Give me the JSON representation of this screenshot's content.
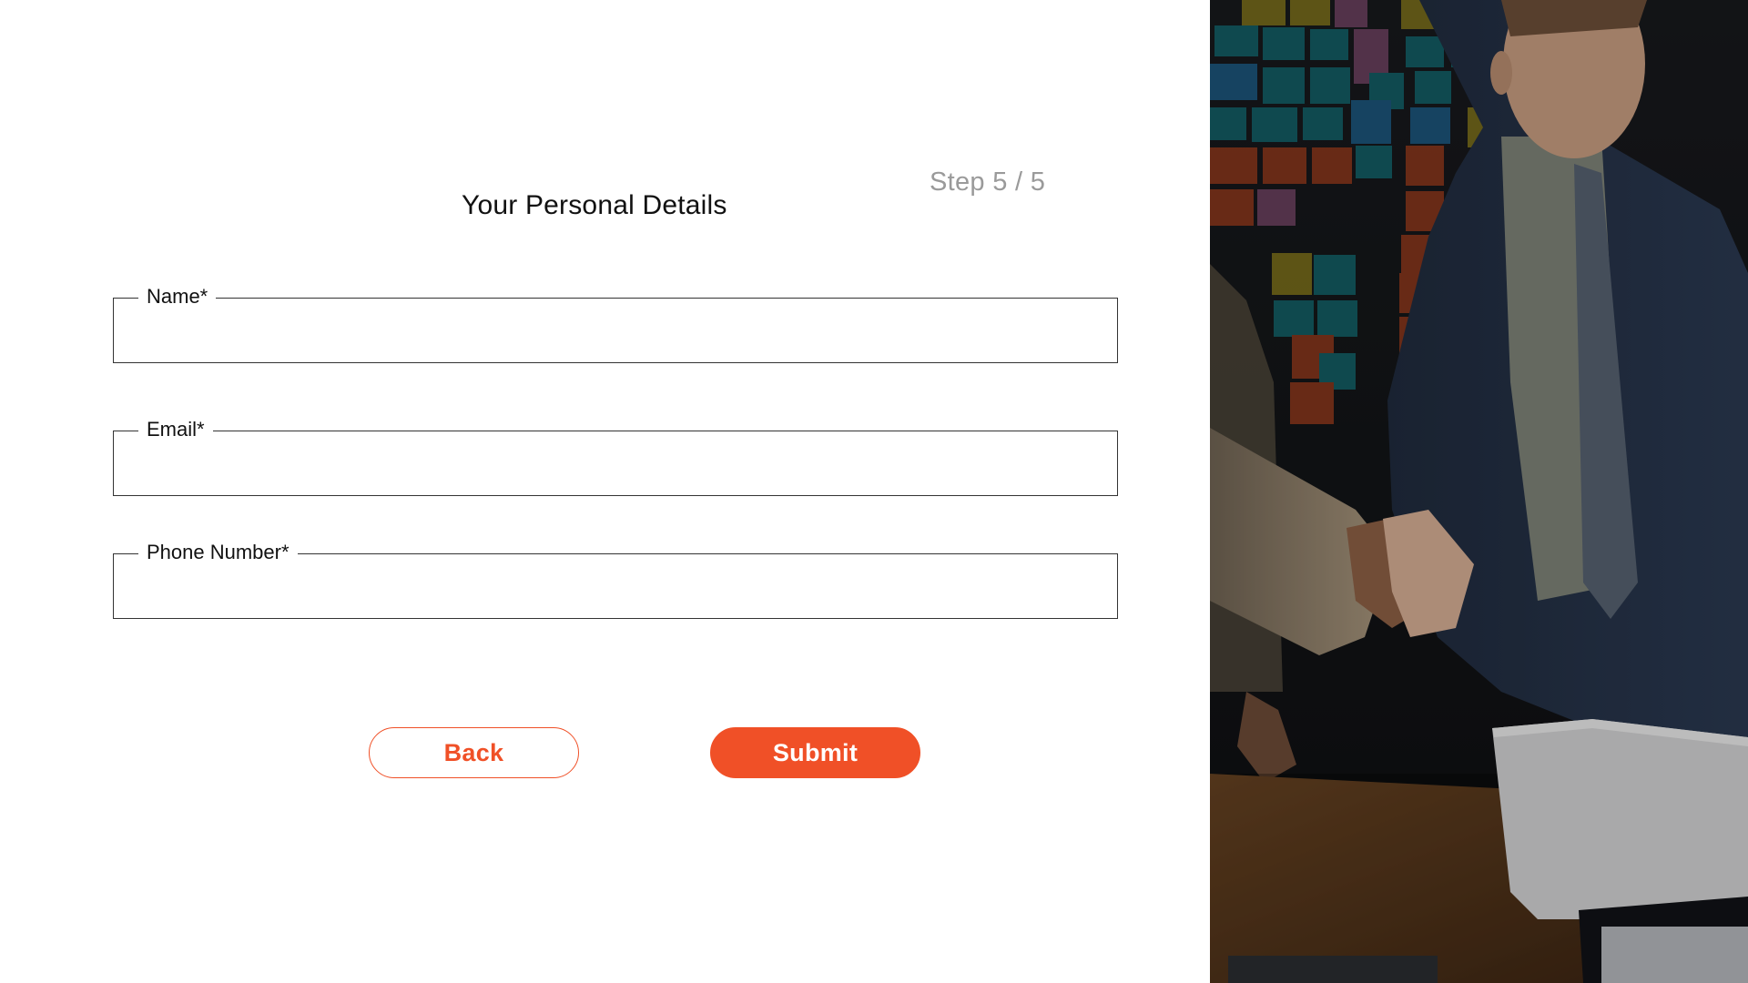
{
  "form": {
    "step": "Step 5 / 5",
    "title": "Your Personal Details",
    "fields": {
      "name": {
        "label": "Name*",
        "value": ""
      },
      "email": {
        "label": "Email*",
        "value": ""
      },
      "phone": {
        "label": "Phone Number*",
        "value": ""
      }
    },
    "buttons": {
      "back": "Back",
      "submit": "Submit"
    }
  },
  "photo": {
    "subject": "business-handshake-meeting-photo"
  },
  "colors": {
    "accent": "#f05027",
    "step_text": "#9a9a9a",
    "field_border": "#333333",
    "text": "#111111",
    "background": "#ffffff"
  }
}
